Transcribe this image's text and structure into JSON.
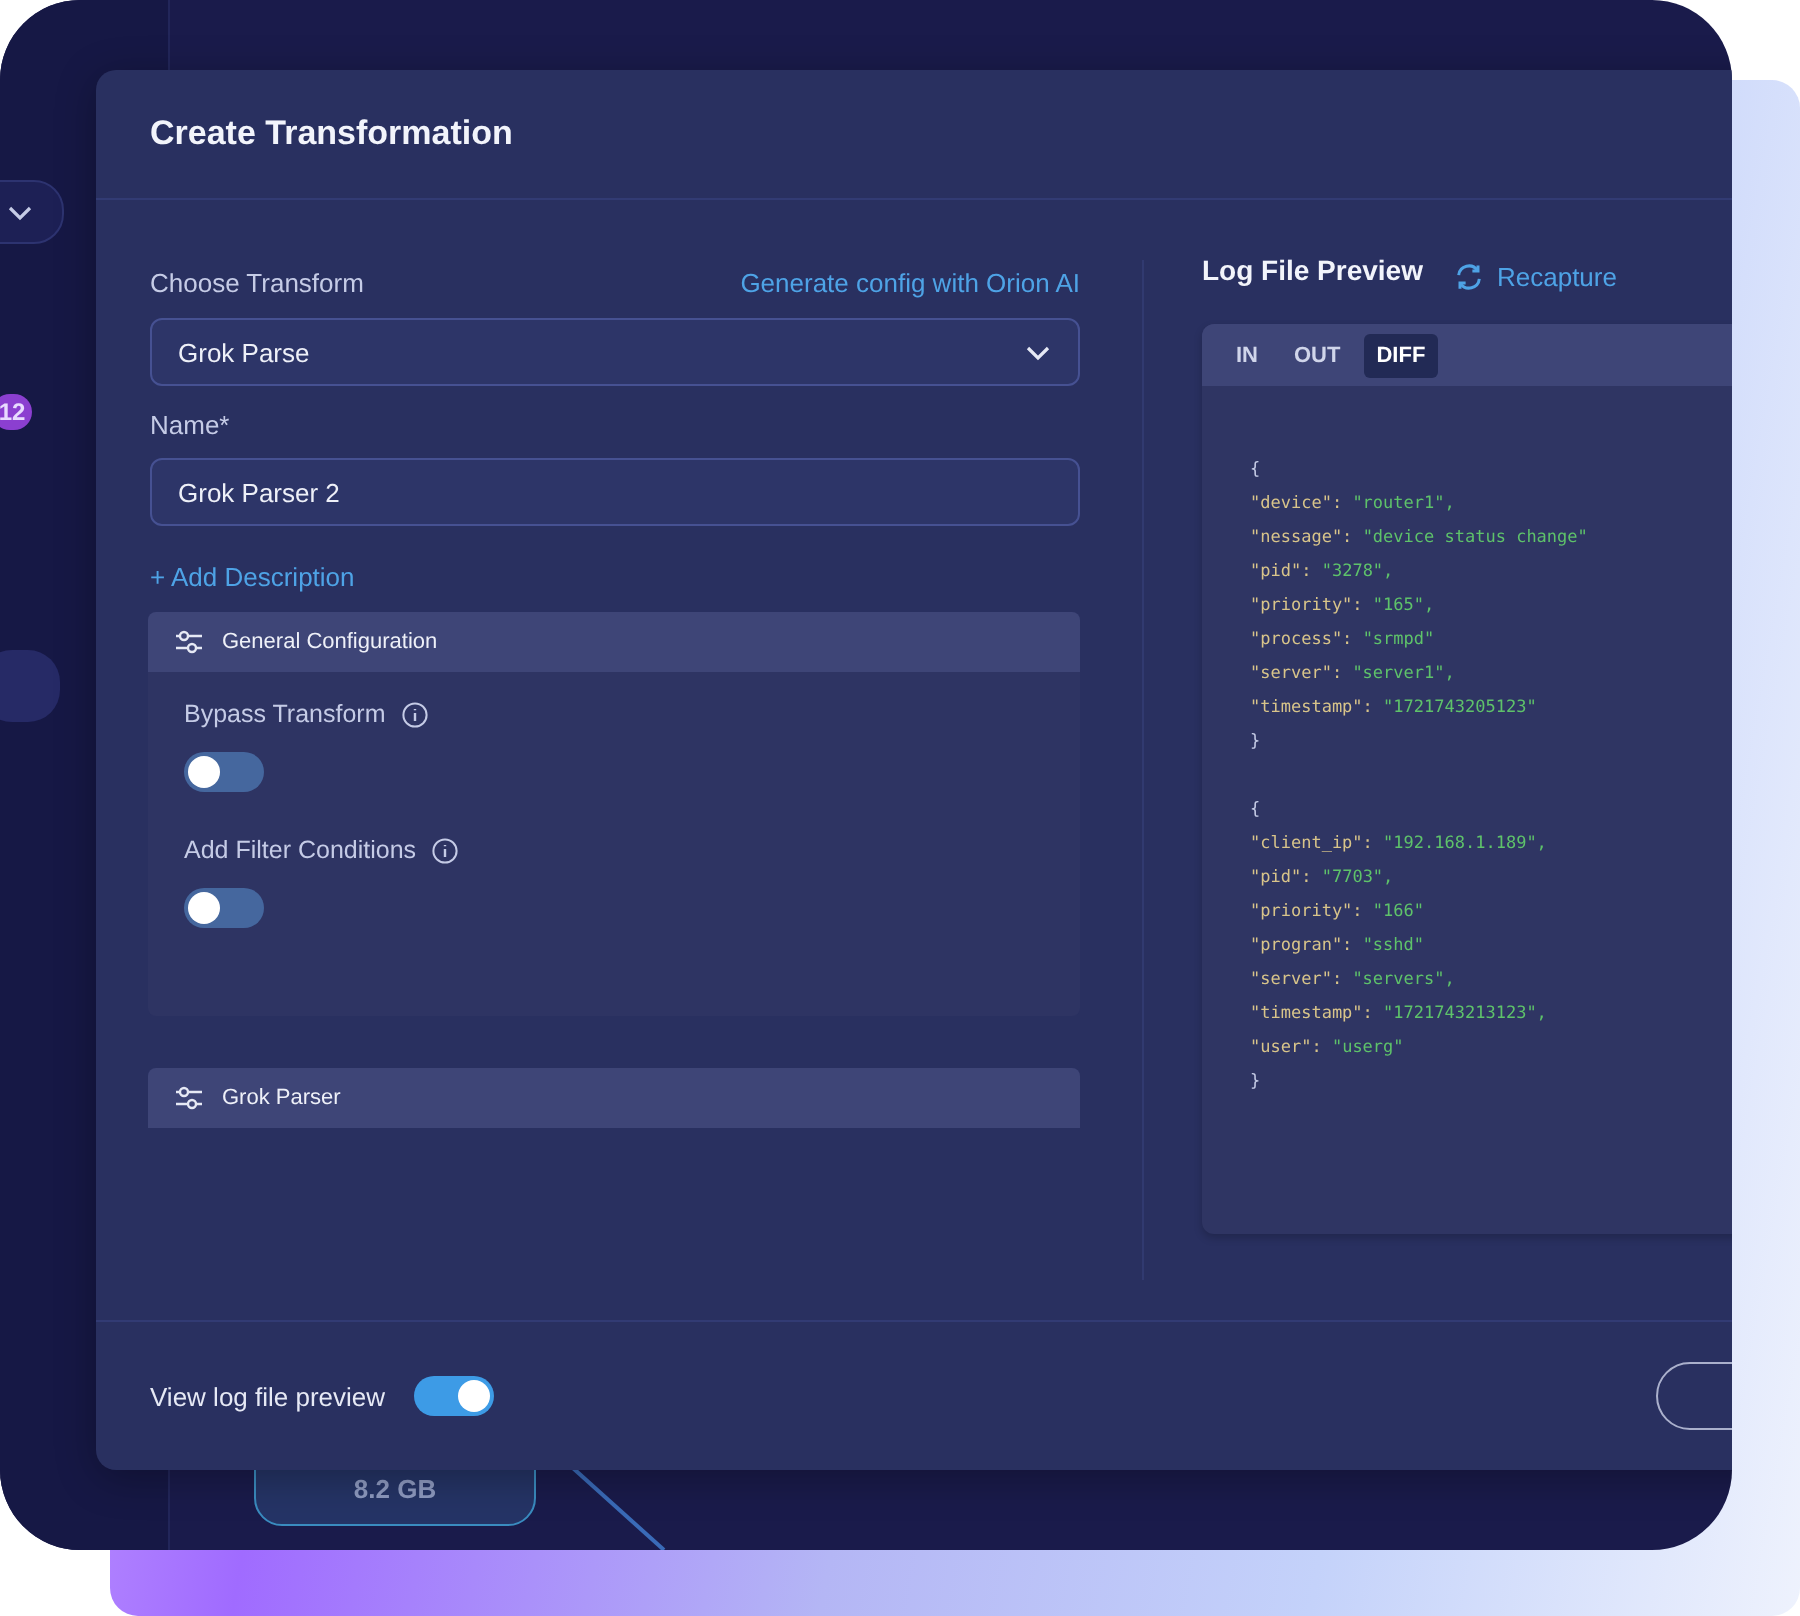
{
  "background": {
    "badge": "12",
    "node_label": "8.2 GB"
  },
  "modal": {
    "title": "Create Transformation"
  },
  "form": {
    "choose_label": "Choose Transform",
    "ai_link": "Generate config with Orion AI",
    "transform": {
      "value": "Grok Parse"
    },
    "name": {
      "label": "Name*",
      "value": "Grok Parser 2"
    },
    "add_description": "+ Add Description"
  },
  "sections": [
    {
      "title": "General Configuration",
      "toggles": [
        {
          "label": "Bypass Transform",
          "on": false
        },
        {
          "label": "Add Filter Conditions",
          "on": false
        }
      ]
    },
    {
      "title": "Grok Parser"
    }
  ],
  "preview": {
    "title": "Log File Preview",
    "recapture": "Recapture",
    "tabs": [
      {
        "label": "IN",
        "selected": false
      },
      {
        "label": "OUT",
        "selected": false
      },
      {
        "label": "DIFF",
        "selected": true
      }
    ],
    "records": [
      {
        "open": "{",
        "close": "}",
        "lines": [
          {
            "key": "\"device\":",
            "value": "\"router1\","
          },
          {
            "key": "\"nessage\":",
            "value": "\"device status change\""
          },
          {
            "key": "\"pid\":",
            "value": "\"3278\","
          },
          {
            "key": "\"priority\":",
            "value": "\"165\","
          },
          {
            "key": "\"process\":",
            "value": "\"srmpd\""
          },
          {
            "key": "\"server\":",
            "value": "\"server1\","
          },
          {
            "key": "\"timestamp\":",
            "value": "\"1721743205123\""
          }
        ]
      },
      {
        "open": "{",
        "close": "}",
        "lines": [
          {
            "key": "\"client_ip\":",
            "value": "\"192.168.1.189\","
          },
          {
            "key": "\"pid\":",
            "value": "\"7703\","
          },
          {
            "key": "\"priority\":",
            "value": "\"166\""
          },
          {
            "key": "\"progran\":",
            "value": "\"sshd\""
          },
          {
            "key": "\"server\":",
            "value": "\"servers\","
          },
          {
            "key": "\"timestamp\":",
            "value": "\"1721743213123\","
          },
          {
            "key": "\"user\":",
            "value": "\"userg\""
          }
        ]
      }
    ]
  },
  "footer": {
    "preview_toggle": {
      "label": "View log file preview",
      "on": true
    }
  }
}
